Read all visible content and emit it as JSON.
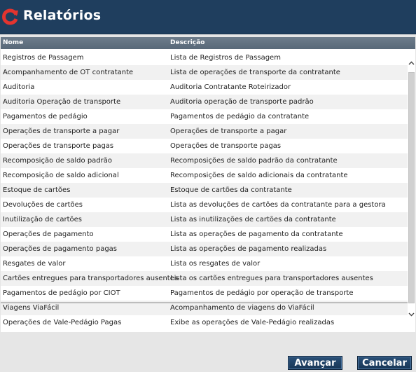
{
  "header": {
    "title": "Relatórios",
    "logo_icon": "refresh-arrow-icon",
    "logo_color": "#e3342f"
  },
  "table": {
    "columns": [
      "Nome",
      "Descrição"
    ],
    "rows": [
      {
        "name": "Registros de Passagem",
        "desc": "Lista de Registros de Passagem"
      },
      {
        "name": "Acompanhamento de OT contratante",
        "desc": "Lista de operações de transporte da contratante"
      },
      {
        "name": "Auditoria",
        "desc": "Auditoria Contratante Roteirizador"
      },
      {
        "name": "Auditoria Operação de transporte",
        "desc": "Auditoria operação de transporte padrão"
      },
      {
        "name": "Pagamentos de pedágio",
        "desc": "Pagamentos de pedágio da contratante"
      },
      {
        "name": "Operações de transporte a pagar",
        "desc": "Operações de transporte a pagar"
      },
      {
        "name": "Operações de transporte pagas",
        "desc": "Operações de transporte pagas"
      },
      {
        "name": "Recomposição de saldo padrão",
        "desc": "Recomposições de saldo padrão da contratante"
      },
      {
        "name": "Recomposição de saldo adicional",
        "desc": "Recomposições de saldo adicionais da contratante"
      },
      {
        "name": "Estoque de cartões",
        "desc": "Estoque de cartões da contratante"
      },
      {
        "name": "Devoluções de cartões",
        "desc": "Lista as devoluções de cartões da contratante para a gestora"
      },
      {
        "name": "Inutilização de cartões",
        "desc": "Lista as inutilizações de cartões da contratante"
      },
      {
        "name": "Operações de pagamento",
        "desc": "Lista as operações de pagamento da contratante"
      },
      {
        "name": "Operações de pagamento pagas",
        "desc": "Lista as operações de pagamento realizadas"
      },
      {
        "name": "Resgates de valor",
        "desc": "Lista os resgates de valor"
      },
      {
        "name": "Cartões entregues para transportadores ausentes",
        "desc": "Lista os cartões entregues para transportadores ausentes"
      },
      {
        "name": "Pagamentos de pedágio por CIOT",
        "desc": "Pagamentos de pedágio por operação de transporte"
      },
      {
        "name": "Viagens ViaFácil",
        "desc": "Acompanhamento de viagens do ViaFácil"
      },
      {
        "name": "Operações de Vale-Pedágio Pagas",
        "desc": "Exibe as operações de Vale-Pedágio realizadas"
      }
    ]
  },
  "buttons": {
    "next": "Avançar",
    "cancel": "Cancelar"
  },
  "colors": {
    "titlebar": "#1f3e5e",
    "header": "#5f6f80",
    "button": "#1f4266"
  }
}
